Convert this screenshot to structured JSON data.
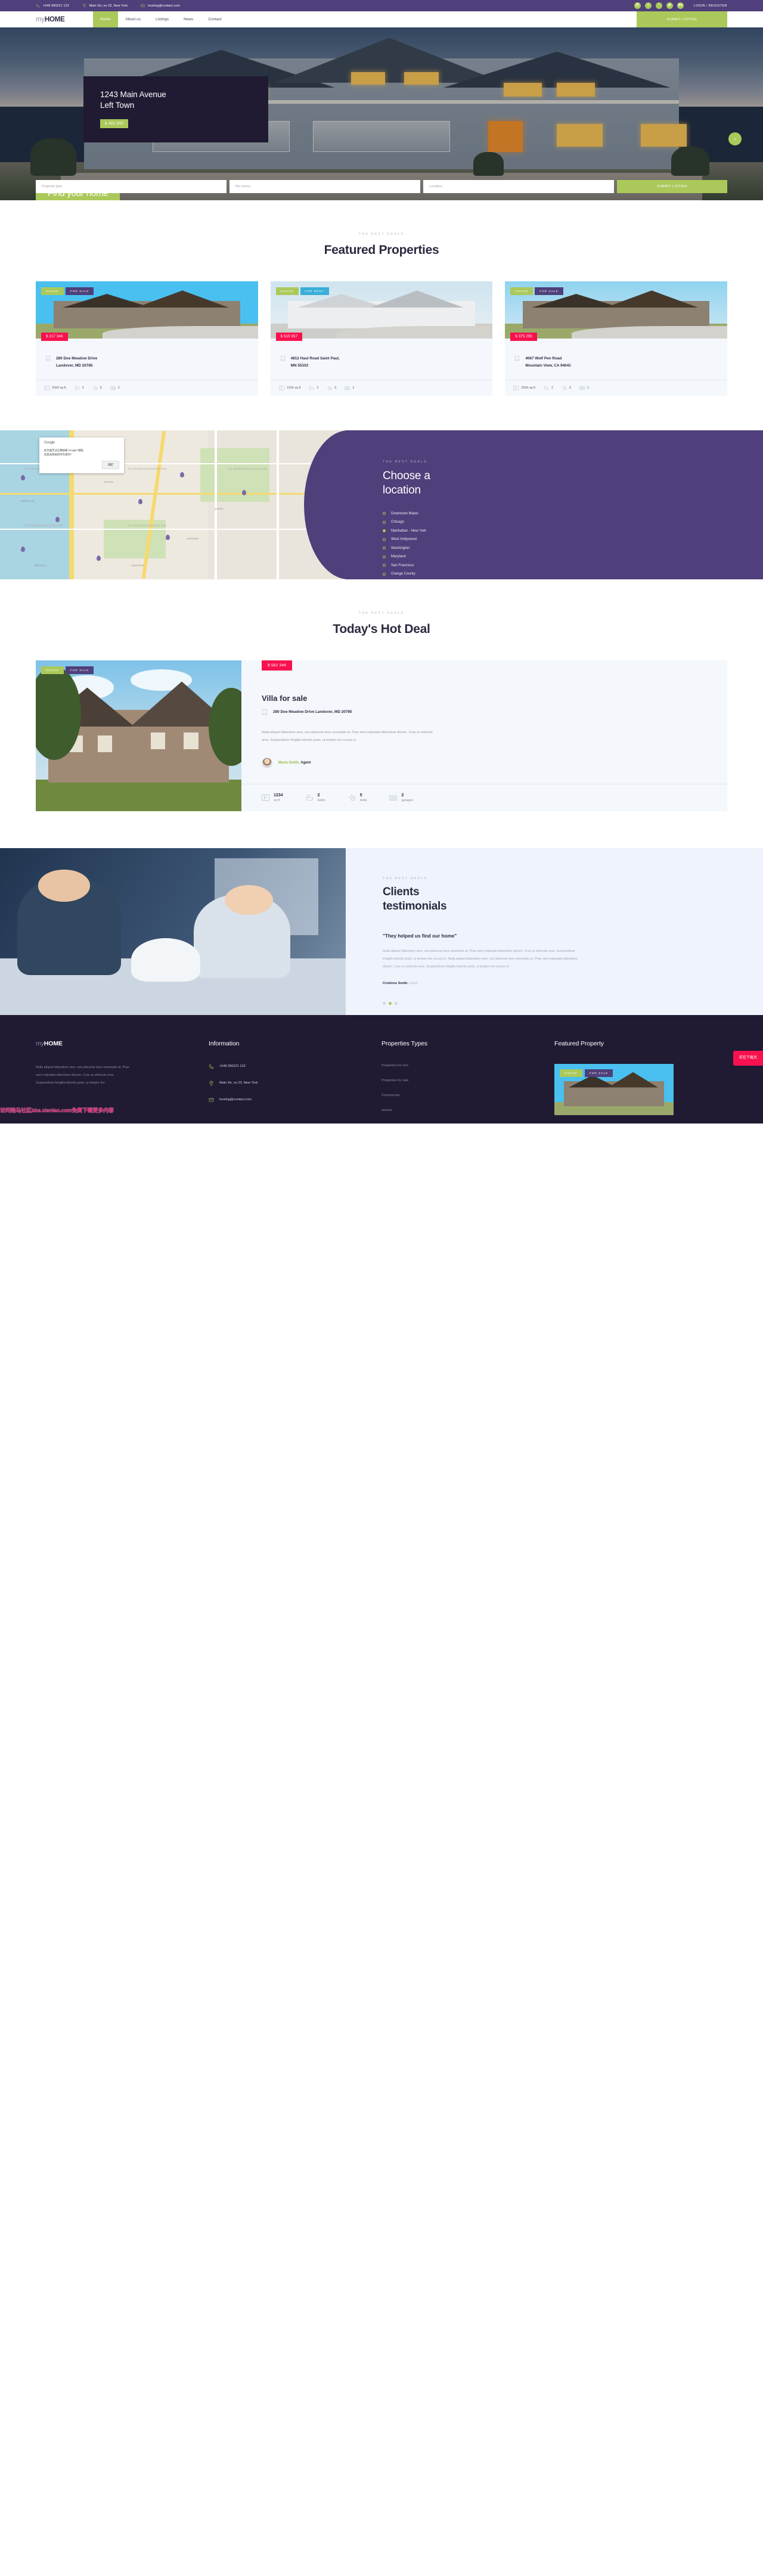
{
  "colors": {
    "purple": "#4f3f7a",
    "green": "#aac95a",
    "dark": "#201a33",
    "pink": "#f8114e",
    "navy": "#2b2a40"
  },
  "topbar": {
    "phone": "+546 990221 123",
    "address": "Main Str, no 23, New York",
    "email": "hosting@contact.com",
    "social": [
      {
        "name": "pinterest-icon",
        "glyph": "Ⓟ"
      },
      {
        "name": "facebook-icon",
        "glyph": "f"
      },
      {
        "name": "twitter-icon",
        "glyph": "ᵗ"
      },
      {
        "name": "dribbble-icon",
        "glyph": "⊛"
      },
      {
        "name": "behance-icon",
        "glyph": "Bē"
      }
    ],
    "login": "LOGIN / REGISTER"
  },
  "nav": {
    "logo_my": "my",
    "logo_home": "HOME",
    "items": [
      {
        "label": "Home",
        "active": true
      },
      {
        "label": "About us",
        "active": false
      },
      {
        "label": "Listings",
        "active": false
      },
      {
        "label": "News",
        "active": false
      },
      {
        "label": "Contact",
        "active": false
      }
    ],
    "submit_listing": "SUBMIT LISTING"
  },
  "hero": {
    "card_title": "1243 Main Avenue\nLeft Town",
    "card_line1": "1243 Main Avenue",
    "card_line2": "Left Town",
    "price": "$ 482 900",
    "next_arrow": "›",
    "find_heading": "Find your home",
    "search": {
      "property_type": "Property type",
      "rooms": "No rooms",
      "location": "Location",
      "submit": "SUBMIT LISTING"
    }
  },
  "featured": {
    "eyebrow": "THE BEST DEALS",
    "title": "Featured Properties",
    "cards": [
      {
        "tag": "HOUSE",
        "status": "FOR SALE",
        "status_type": "for-sale",
        "price": "$ 217 346",
        "addr_line1": "280 Doe Meadow Drive",
        "addr_line2": "Landover, MD 20785",
        "sqft": "2500 sq ft",
        "baths": "2",
        "beds": "5",
        "garages": "2"
      },
      {
        "tag": "HOUSE",
        "status": "FOR RENT",
        "status_type": "for-rent",
        "price": "$ 515 957",
        "addr_line1": "4812 Haul Road Saint Paul,",
        "addr_line2": "MN 55102",
        "sqft": "1234 sq ft",
        "baths": "2",
        "beds": "5",
        "garages": "2"
      },
      {
        "tag": "HOUSE",
        "status": "FOR SALE",
        "status_type": "for-sale",
        "price": "$ 375 255",
        "addr_line1": "4067 Wolf Pen Road",
        "addr_line2": "Mountain View, CA 94041",
        "sqft": "2000 sq ft",
        "baths": "2",
        "beds": "5",
        "garages": "2"
      }
    ]
  },
  "map_dialog": {
    "logo": "Google",
    "text": "此页面无法正确加载 Google 地图。",
    "subtext": "您是此网站的所有者吗？",
    "ok": "确定"
  },
  "map_labels": [
    "For development purposes only",
    "For development purposes only",
    "For development purposes only",
    "For development purposes only",
    "For development purposes only",
    "ASTORIA",
    "QUEENS",
    "BROOKLYN",
    "SUNNYSIDE",
    "MURRAY HILL",
    "WOODSIDE",
    "GREENPOINT"
  ],
  "location": {
    "eyebrow": "THE BEST DEALS",
    "title_line1": "Choose a",
    "title_line2": "location",
    "items": [
      {
        "label": "Downtown Miami",
        "selected": false
      },
      {
        "label": "Chicago",
        "selected": false
      },
      {
        "label": "Manhattan - New York",
        "selected": true
      },
      {
        "label": "West Hollywood",
        "selected": false
      },
      {
        "label": "Washington",
        "selected": false
      },
      {
        "label": "Maryland",
        "selected": false
      },
      {
        "label": "San Francisco",
        "selected": false
      },
      {
        "label": "Orange County",
        "selected": false
      }
    ]
  },
  "hotdeal": {
    "eyebrow": "THE BEST DEALS",
    "title": "Today's Hot Deal",
    "tag": "HOUSE",
    "status": "FOR SALE",
    "price": "$ 562 346",
    "name": "Villa for sale",
    "address": "280 Doe Meadow Drive Landover, MD 20785",
    "description": "Nulla aliquet bibendum sem, non placerat risus venenatis at. Prae sent vulputate bibendum dictum. Cras at vehicula urna. Suspendisse fringilla lobortis justo, ut tempor leo cursus in.",
    "agent_name": "Maria Smith,",
    "agent_role": "Agent",
    "stats": [
      {
        "value": "1234",
        "unit": "sq ft",
        "icon": "floorplan-icon"
      },
      {
        "value": "2",
        "unit": "baths",
        "icon": "bath-icon"
      },
      {
        "value": "5",
        "unit": "beds",
        "icon": "bed-icon"
      },
      {
        "value": "2",
        "unit": "garages",
        "icon": "garage-icon"
      }
    ]
  },
  "testimonials": {
    "eyebrow": "THE BEST DEALS",
    "title_line1": "Clients",
    "title_line2": "testimonials",
    "quote": "\"They helped us find our home\"",
    "text": "Nulla aliquet bibendum sem, non placerat risus venenatis at. Prae sent vulputate bibendum dictum. Cras at vehicula urna. Suspendisse fringilla lobortis justo, ut tempor leo cursus in. Nulla aliquet bibendum sem, non placerat risus venenatis at. Prae sent vulputate bibendum dictum. Cras at vehicula urna. Suspendisse fringilla lobortis justo, ut tempor leo cursus in.",
    "author_name": "Cristinne Smith,",
    "author_role": "Client",
    "active_dot": 1
  },
  "footer": {
    "brand_my": "my",
    "brand_home": "HOME",
    "about": "Nulla aliquet bibendum sem, non placerat risus venenatis at. Prae sent vulputate bibendum dictum. Cras at vehicula urna. Suspendisse fringilla lobortis justo, ut tempor leo",
    "info_title": "Information",
    "info": [
      {
        "icon": "phone-icon",
        "text": "+546 990221 123"
      },
      {
        "icon": "pin-icon",
        "text": "Main Str, no 23, New York"
      },
      {
        "icon": "mail-icon",
        "text": "hosting@contact.com"
      }
    ],
    "types_title": "Properties Types",
    "types": [
      "Properties for rent",
      "Properties for sale",
      "Commercial",
      "Homes"
    ],
    "featured_title": "Featured Property",
    "featured_tag": "HOUSE",
    "featured_status": "FOR SALE",
    "download_badge": "前往下载页",
    "watermark": "访问险马社区bbs.xienlao.com免费下载更多内容"
  }
}
